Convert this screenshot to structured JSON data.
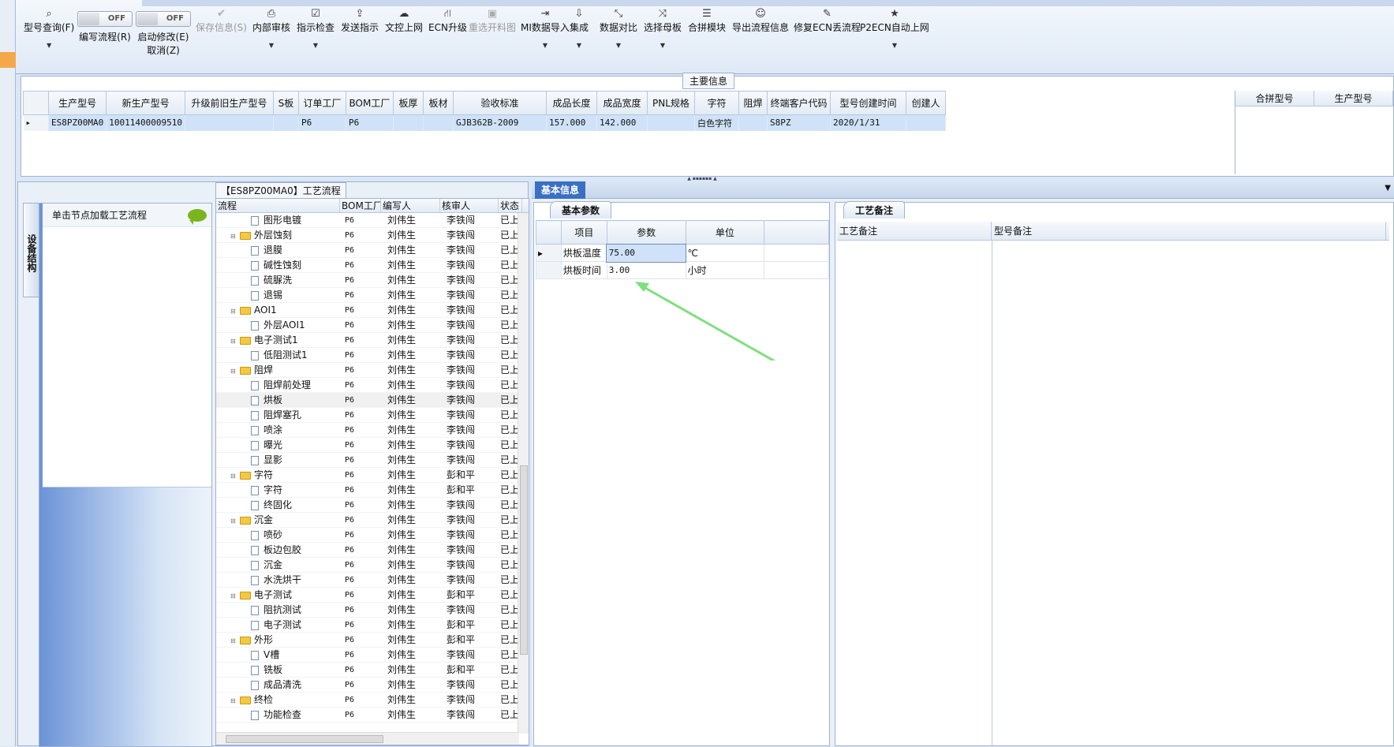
{
  "toolbar": {
    "items": [
      {
        "label": "型号查询(F)",
        "icon": "search-icon",
        "disabled": false,
        "dropdown": true
      },
      {
        "label": "编写流程(R)",
        "toggle": "OFF"
      },
      {
        "label": "启动修改(E)",
        "toggle": "OFF",
        "sub": "取消(Z)"
      },
      {
        "label": "保存信息(S)",
        "icon": "check-icon",
        "disabled": true
      },
      {
        "label": "内部审核",
        "icon": "print-icon",
        "dropdown": true
      },
      {
        "label": "指示检查",
        "icon": "checkbox-icon",
        "dropdown": true
      },
      {
        "label": "发送指示",
        "icon": "upload-icon"
      },
      {
        "label": "文控上网",
        "icon": "cloud-upload-icon"
      },
      {
        "label": "ECN升级",
        "icon": "road-icon"
      },
      {
        "label": "重选开料图",
        "icon": "picture-icon",
        "disabled": true
      },
      {
        "label": "MI数据导入",
        "icon": "sign-in-icon",
        "dropdown": true
      },
      {
        "label": "集成",
        "icon": "download-icon",
        "dropdown": true
      },
      {
        "label": "数据对比",
        "icon": "compress-icon",
        "dropdown": true
      },
      {
        "label": "选择母板",
        "icon": "shuffle-icon",
        "dropdown": true
      },
      {
        "label": "合拼模块",
        "icon": "list-icon"
      },
      {
        "label": "导出流程信息",
        "icon": "smile-icon"
      },
      {
        "label": "修复ECN丢流程",
        "icon": "wrench-icon"
      },
      {
        "label": "P2ECN自动上网",
        "icon": "star-icon",
        "dropdown": true
      }
    ]
  },
  "main_info": {
    "title": "主要信息",
    "columns": [
      "生产型号",
      "新生产型号",
      "升级前旧生产型号",
      "S板",
      "订单工厂",
      "BOM工厂",
      "板厚",
      "板材",
      "验收标准",
      "成品长度",
      "成品宽度",
      "PNL规格",
      "字符",
      "阻焊",
      "终端客户代码",
      "型号创建时间",
      "创建人"
    ],
    "rows": [
      [
        "ES8PZ00MA0",
        "10011400009510",
        "",
        "",
        "P6",
        "P6",
        "",
        "",
        "GJB362B-2009",
        "157.000",
        "142.000",
        "",
        "白色字符",
        "",
        "S8PZ",
        "2020/1/31",
        ""
      ]
    ],
    "side_columns": [
      "合拼型号",
      "生产型号"
    ]
  },
  "flow": {
    "title": "【ES8PZ00MA0】工艺流程",
    "vertical_tab": "设备结构",
    "left_header": "单击节点加载工艺流程",
    "columns": [
      "流程",
      "BOM工厂",
      "编写人",
      "核审人",
      "状态"
    ],
    "rows": [
      {
        "name": "图形电镀",
        "level": 2,
        "bom": "P6",
        "writer": "刘伟生",
        "checker": "李铁闯",
        "status": "已上网"
      },
      {
        "name": "外层蚀刻",
        "level": 1,
        "bom": "P6",
        "writer": "刘伟生",
        "checker": "李铁闯",
        "status": "已上网"
      },
      {
        "name": "退膜",
        "level": 2,
        "bom": "P6",
        "writer": "刘伟生",
        "checker": "李铁闯",
        "status": "已上网"
      },
      {
        "name": "碱性蚀刻",
        "level": 2,
        "bom": "P6",
        "writer": "刘伟生",
        "checker": "李铁闯",
        "status": "已上网"
      },
      {
        "name": "硫脲洗",
        "level": 2,
        "bom": "P6",
        "writer": "刘伟生",
        "checker": "李铁闯",
        "status": "已上网"
      },
      {
        "name": "退锡",
        "level": 2,
        "bom": "P6",
        "writer": "刘伟生",
        "checker": "李铁闯",
        "status": "已上网"
      },
      {
        "name": "AOI1",
        "level": 1,
        "bom": "P6",
        "writer": "刘伟生",
        "checker": "李铁闯",
        "status": "已上网"
      },
      {
        "name": "外层AOI1",
        "level": 2,
        "bom": "P6",
        "writer": "刘伟生",
        "checker": "李铁闯",
        "status": "已上网"
      },
      {
        "name": "电子测试1",
        "level": 1,
        "bom": "P6",
        "writer": "刘伟生",
        "checker": "李铁闯",
        "status": "已上网"
      },
      {
        "name": "低阻测试1",
        "level": 2,
        "bom": "P6",
        "writer": "刘伟生",
        "checker": "李铁闯",
        "status": "已上网"
      },
      {
        "name": "阻焊",
        "level": 1,
        "bom": "P6",
        "writer": "刘伟生",
        "checker": "李铁闯",
        "status": "已上网"
      },
      {
        "name": "阻焊前处理",
        "level": 2,
        "bom": "P6",
        "writer": "刘伟生",
        "checker": "李铁闯",
        "status": "已上网"
      },
      {
        "name": "烘板",
        "level": 2,
        "bom": "P6",
        "writer": "刘伟生",
        "checker": "李铁闯",
        "status": "已上网",
        "selected": true
      },
      {
        "name": "阻焊塞孔",
        "level": 2,
        "bom": "P6",
        "writer": "刘伟生",
        "checker": "李铁闯",
        "status": "已上网"
      },
      {
        "name": "喷涂",
        "level": 2,
        "bom": "P6",
        "writer": "刘伟生",
        "checker": "李铁闯",
        "status": "已上网"
      },
      {
        "name": "曝光",
        "level": 2,
        "bom": "P6",
        "writer": "刘伟生",
        "checker": "李铁闯",
        "status": "已上网"
      },
      {
        "name": "显影",
        "level": 2,
        "bom": "P6",
        "writer": "刘伟生",
        "checker": "李铁闯",
        "status": "已上网"
      },
      {
        "name": "字符",
        "level": 1,
        "bom": "P6",
        "writer": "刘伟生",
        "checker": "彭和平",
        "status": "已上网"
      },
      {
        "name": "字符",
        "level": 2,
        "bom": "P6",
        "writer": "刘伟生",
        "checker": "彭和平",
        "status": "已上网"
      },
      {
        "name": "终固化",
        "level": 2,
        "bom": "P6",
        "writer": "刘伟生",
        "checker": "李铁闯",
        "status": "已上网"
      },
      {
        "name": "沉金",
        "level": 1,
        "bom": "P6",
        "writer": "刘伟生",
        "checker": "李铁闯",
        "status": "已上网"
      },
      {
        "name": "喷砂",
        "level": 2,
        "bom": "P6",
        "writer": "刘伟生",
        "checker": "李铁闯",
        "status": "已上网"
      },
      {
        "name": "板边包胶",
        "level": 2,
        "bom": "P6",
        "writer": "刘伟生",
        "checker": "李铁闯",
        "status": "已上网"
      },
      {
        "name": "沉金",
        "level": 2,
        "bom": "P6",
        "writer": "刘伟生",
        "checker": "李铁闯",
        "status": "已上网"
      },
      {
        "name": "水洗烘干",
        "level": 2,
        "bom": "P6",
        "writer": "刘伟生",
        "checker": "李铁闯",
        "status": "已上网"
      },
      {
        "name": "电子测试",
        "level": 1,
        "bom": "P6",
        "writer": "刘伟生",
        "checker": "彭和平",
        "status": "已上网"
      },
      {
        "name": "阻抗测试",
        "level": 2,
        "bom": "P6",
        "writer": "刘伟生",
        "checker": "李铁闯",
        "status": "已上网"
      },
      {
        "name": "电子测试",
        "level": 2,
        "bom": "P6",
        "writer": "刘伟生",
        "checker": "彭和平",
        "status": "已上网"
      },
      {
        "name": "外形",
        "level": 1,
        "bom": "P6",
        "writer": "刘伟生",
        "checker": "彭和平",
        "status": "已上网"
      },
      {
        "name": "V槽",
        "level": 2,
        "bom": "P6",
        "writer": "刘伟生",
        "checker": "李铁闯",
        "status": "已上网"
      },
      {
        "name": "铣板",
        "level": 2,
        "bom": "P6",
        "writer": "刘伟生",
        "checker": "彭和平",
        "status": "已上网"
      },
      {
        "name": "成品清洗",
        "level": 2,
        "bom": "P6",
        "writer": "刘伟生",
        "checker": "李铁闯",
        "status": "已上网"
      },
      {
        "name": "终检",
        "level": 1,
        "bom": "P6",
        "writer": "刘伟生",
        "checker": "李铁闯",
        "status": "已上网"
      },
      {
        "name": "功能检查",
        "level": 2,
        "bom": "P6",
        "writer": "刘伟生",
        "checker": "李铁闯",
        "status": "已上网"
      }
    ]
  },
  "basic": {
    "tab": "基本信息",
    "params_tab": "基本参数",
    "param_columns": [
      "项目",
      "参数",
      "单位"
    ],
    "params": [
      {
        "item": "烘板温度",
        "value": "75.00",
        "unit": "℃"
      },
      {
        "item": "烘板时间",
        "value": "3.00",
        "unit": "小时"
      }
    ],
    "remark_tab": "工艺备注",
    "remark_columns": [
      "工艺备注",
      "型号备注"
    ]
  },
  "colors": {
    "accent": "#3a6fc4",
    "selection": "#cfe2f8",
    "arrow": "#7ee07e"
  }
}
